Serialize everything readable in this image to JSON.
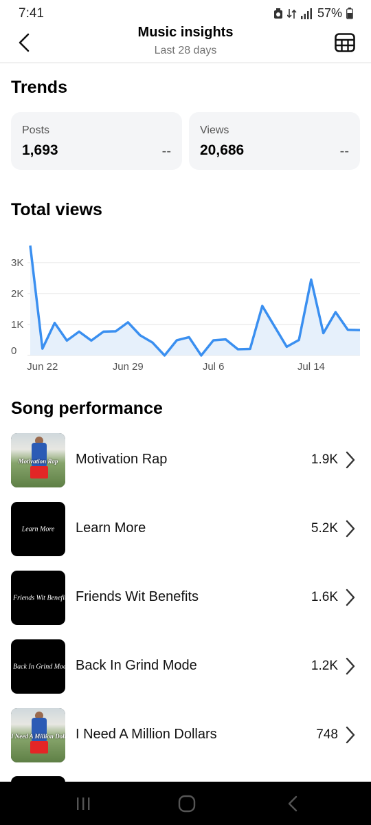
{
  "status": {
    "time": "7:41",
    "battery": "57%"
  },
  "header": {
    "title": "Music insights",
    "subtitle": "Last 28 days"
  },
  "trends": {
    "title": "Trends",
    "cards": [
      {
        "label": "Posts",
        "value": "1,693",
        "delta": "--"
      },
      {
        "label": "Views",
        "value": "20,686",
        "delta": "--"
      }
    ]
  },
  "total_views": {
    "title": "Total views"
  },
  "chart_data": {
    "type": "area",
    "title": "Total views",
    "x_tick_labels": [
      "Jun 22",
      "Jun 29",
      "Jul 6",
      "Jul 14"
    ],
    "y_tick_labels": [
      "0",
      "1K",
      "2K",
      "3K"
    ],
    "ylim": [
      0,
      3500
    ],
    "grid": true,
    "color": "#3a8ff0",
    "fill_color": "#e6f0fb",
    "x": [
      "Jun 21",
      "Jun 22",
      "Jun 23",
      "Jun 24",
      "Jun 25",
      "Jun 26",
      "Jun 27",
      "Jun 28",
      "Jun 29",
      "Jun 30",
      "Jul 1",
      "Jul 2",
      "Jul 3",
      "Jul 4",
      "Jul 5",
      "Jul 6",
      "Jul 7",
      "Jul 8",
      "Jul 9",
      "Jul 10",
      "Jul 11",
      "Jul 12",
      "Jul 13",
      "Jul 14",
      "Jul 15",
      "Jul 16",
      "Jul 17",
      "Jul 18"
    ],
    "values": [
      3550,
      220,
      1050,
      480,
      770,
      480,
      770,
      780,
      1070,
      650,
      420,
      0,
      490,
      590,
      0,
      490,
      520,
      200,
      210,
      1600,
      940,
      280,
      500,
      2450,
      720,
      1400,
      830,
      820
    ]
  },
  "songs": {
    "title": "Song performance",
    "items": [
      {
        "title": "Motivation Rap",
        "views": "1.9K",
        "thumb_text": "Motivation Rap",
        "thumb_style": "photo"
      },
      {
        "title": "Learn More",
        "views": "5.2K",
        "thumb_text": "Learn More",
        "thumb_style": "black"
      },
      {
        "title": "Friends Wit Benefits",
        "views": "1.6K",
        "thumb_text": "Friends Wit Benefits",
        "thumb_style": "black"
      },
      {
        "title": "Back In Grind Mode",
        "views": "1.2K",
        "thumb_text": "Back In Grind Mode",
        "thumb_style": "black"
      },
      {
        "title": "I Need A Million Dollars",
        "views": "748",
        "thumb_text": "I Need A Million Dollars",
        "thumb_style": "photo"
      }
    ]
  },
  "icons": {
    "back": "chevron-left-icon",
    "table": "table-icon",
    "row_chevron": "chevron-right-icon",
    "nav_recents": "recents-icon",
    "nav_home": "home-icon",
    "nav_back": "back-icon"
  }
}
